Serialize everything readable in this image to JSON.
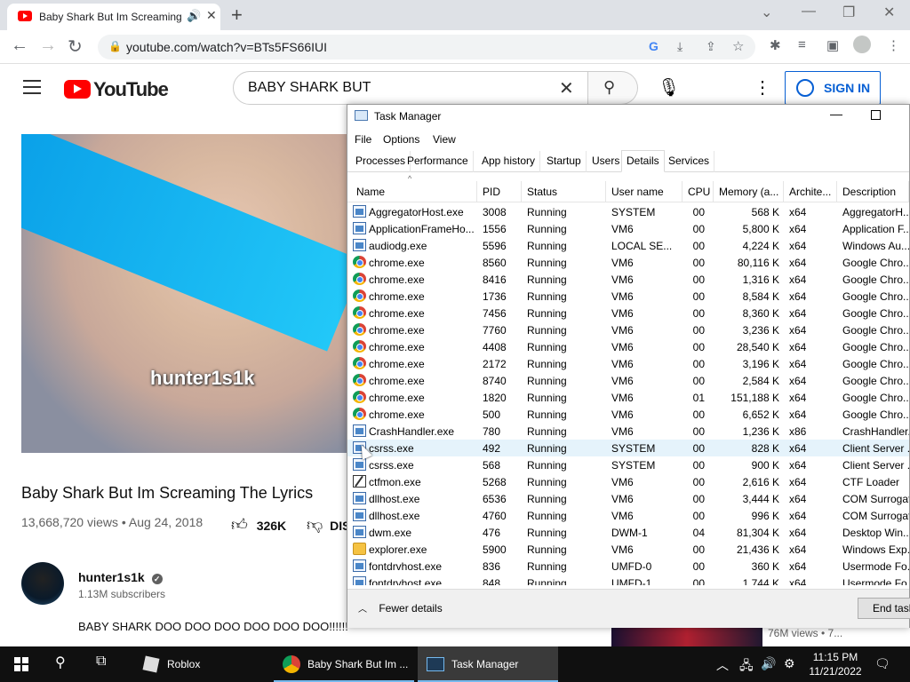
{
  "browser": {
    "tab_title": "Baby Shark But Im Screaming The Lyrics",
    "url": "youtube.com/watch?v=BTs5FS66IUI"
  },
  "youtube": {
    "logo_text": "YouTube",
    "search_query": "BABY SHARK BUT",
    "sign_in": "SIGN IN",
    "video_watermark": "hunter1s1k",
    "video_title": "Baby Shark But Im Screaming The Lyrics",
    "video_meta": "13,668,720 views • Aug 24, 2018",
    "likes": "326K",
    "dislike_label": "DIS",
    "channel_name": "hunter1s1k",
    "subscribers": "1.13M subscribers",
    "description": "BABY SHARK DOO DOO DOO DOO DOO DOO!!!!!!",
    "side_meta": "76M views • 7..."
  },
  "taskmanager": {
    "title": "Task Manager",
    "menu": [
      "File",
      "Options",
      "View"
    ],
    "tabs": [
      "Processes",
      "Performance",
      "App history",
      "Startup",
      "Users",
      "Details",
      "Services"
    ],
    "active_tab": "Details",
    "columns": [
      "Name",
      "PID",
      "Status",
      "User name",
      "CPU",
      "Memory (a...",
      "Archite...",
      "Description"
    ],
    "rows": [
      {
        "icon": "exe",
        "name": "AggregatorHost.exe",
        "pid": "3008",
        "status": "Running",
        "user": "SYSTEM",
        "cpu": "00",
        "mem": "568 K",
        "arch": "x64",
        "desc": "AggregatorH..."
      },
      {
        "icon": "exe",
        "name": "ApplicationFrameHo...",
        "pid": "1556",
        "status": "Running",
        "user": "VM6",
        "cpu": "00",
        "mem": "5,800 K",
        "arch": "x64",
        "desc": "Application F..."
      },
      {
        "icon": "exe",
        "name": "audiodg.exe",
        "pid": "5596",
        "status": "Running",
        "user": "LOCAL SE...",
        "cpu": "00",
        "mem": "4,224 K",
        "arch": "x64",
        "desc": "Windows Au..."
      },
      {
        "icon": "chrome",
        "name": "chrome.exe",
        "pid": "8560",
        "status": "Running",
        "user": "VM6",
        "cpu": "00",
        "mem": "80,116 K",
        "arch": "x64",
        "desc": "Google Chro..."
      },
      {
        "icon": "chrome",
        "name": "chrome.exe",
        "pid": "8416",
        "status": "Running",
        "user": "VM6",
        "cpu": "00",
        "mem": "1,316 K",
        "arch": "x64",
        "desc": "Google Chro..."
      },
      {
        "icon": "chrome",
        "name": "chrome.exe",
        "pid": "1736",
        "status": "Running",
        "user": "VM6",
        "cpu": "00",
        "mem": "8,584 K",
        "arch": "x64",
        "desc": "Google Chro..."
      },
      {
        "icon": "chrome",
        "name": "chrome.exe",
        "pid": "7456",
        "status": "Running",
        "user": "VM6",
        "cpu": "00",
        "mem": "8,360 K",
        "arch": "x64",
        "desc": "Google Chro..."
      },
      {
        "icon": "chrome",
        "name": "chrome.exe",
        "pid": "7760",
        "status": "Running",
        "user": "VM6",
        "cpu": "00",
        "mem": "3,236 K",
        "arch": "x64",
        "desc": "Google Chro..."
      },
      {
        "icon": "chrome",
        "name": "chrome.exe",
        "pid": "4408",
        "status": "Running",
        "user": "VM6",
        "cpu": "00",
        "mem": "28,540 K",
        "arch": "x64",
        "desc": "Google Chro..."
      },
      {
        "icon": "chrome",
        "name": "chrome.exe",
        "pid": "2172",
        "status": "Running",
        "user": "VM6",
        "cpu": "00",
        "mem": "3,196 K",
        "arch": "x64",
        "desc": "Google Chro..."
      },
      {
        "icon": "chrome",
        "name": "chrome.exe",
        "pid": "8740",
        "status": "Running",
        "user": "VM6",
        "cpu": "00",
        "mem": "2,584 K",
        "arch": "x64",
        "desc": "Google Chro..."
      },
      {
        "icon": "chrome",
        "name": "chrome.exe",
        "pid": "1820",
        "status": "Running",
        "user": "VM6",
        "cpu": "01",
        "mem": "151,188 K",
        "arch": "x64",
        "desc": "Google Chro..."
      },
      {
        "icon": "chrome",
        "name": "chrome.exe",
        "pid": "500",
        "status": "Running",
        "user": "VM6",
        "cpu": "00",
        "mem": "6,652 K",
        "arch": "x64",
        "desc": "Google Chro..."
      },
      {
        "icon": "exe",
        "name": "CrashHandler.exe",
        "pid": "780",
        "status": "Running",
        "user": "VM6",
        "cpu": "00",
        "mem": "1,236 K",
        "arch": "x86",
        "desc": "CrashHandler..."
      },
      {
        "icon": "exe",
        "name": "csrss.exe",
        "pid": "492",
        "status": "Running",
        "user": "SYSTEM",
        "cpu": "00",
        "mem": "828 K",
        "arch": "x64",
        "desc": "Client Server ...",
        "selected": true
      },
      {
        "icon": "exe",
        "name": "csrss.exe",
        "pid": "568",
        "status": "Running",
        "user": "SYSTEM",
        "cpu": "00",
        "mem": "900 K",
        "arch": "x64",
        "desc": "Client Server ..."
      },
      {
        "icon": "pen",
        "name": "ctfmon.exe",
        "pid": "5268",
        "status": "Running",
        "user": "VM6",
        "cpu": "00",
        "mem": "2,616 K",
        "arch": "x64",
        "desc": "CTF Loader"
      },
      {
        "icon": "exe",
        "name": "dllhost.exe",
        "pid": "6536",
        "status": "Running",
        "user": "VM6",
        "cpu": "00",
        "mem": "3,444 K",
        "arch": "x64",
        "desc": "COM Surrogat..."
      },
      {
        "icon": "exe",
        "name": "dllhost.exe",
        "pid": "4760",
        "status": "Running",
        "user": "VM6",
        "cpu": "00",
        "mem": "996 K",
        "arch": "x64",
        "desc": "COM Surrogat..."
      },
      {
        "icon": "exe",
        "name": "dwm.exe",
        "pid": "476",
        "status": "Running",
        "user": "DWM-1",
        "cpu": "04",
        "mem": "81,304 K",
        "arch": "x64",
        "desc": "Desktop Win..."
      },
      {
        "icon": "folder",
        "name": "explorer.exe",
        "pid": "5900",
        "status": "Running",
        "user": "VM6",
        "cpu": "00",
        "mem": "21,436 K",
        "arch": "x64",
        "desc": "Windows Exp..."
      },
      {
        "icon": "exe",
        "name": "fontdrvhost.exe",
        "pid": "836",
        "status": "Running",
        "user": "UMFD-0",
        "cpu": "00",
        "mem": "360 K",
        "arch": "x64",
        "desc": "Usermode Fo..."
      },
      {
        "icon": "exe",
        "name": "fontdrvhost.exe",
        "pid": "848",
        "status": "Running",
        "user": "UMFD-1",
        "cpu": "00",
        "mem": "1,744 K",
        "arch": "x64",
        "desc": "Usermode Fo..."
      }
    ],
    "fewer_details": "Fewer details",
    "end_task": "End task"
  },
  "taskbar": {
    "apps": [
      {
        "label": "Roblox",
        "icon": "roblox-icon"
      },
      {
        "label": "Baby Shark But Im ...",
        "icon": "chrome-icon"
      },
      {
        "label": "Task Manager",
        "icon": "task-manager-icon"
      }
    ],
    "time": "11:15 PM",
    "date": "11/21/2022"
  }
}
